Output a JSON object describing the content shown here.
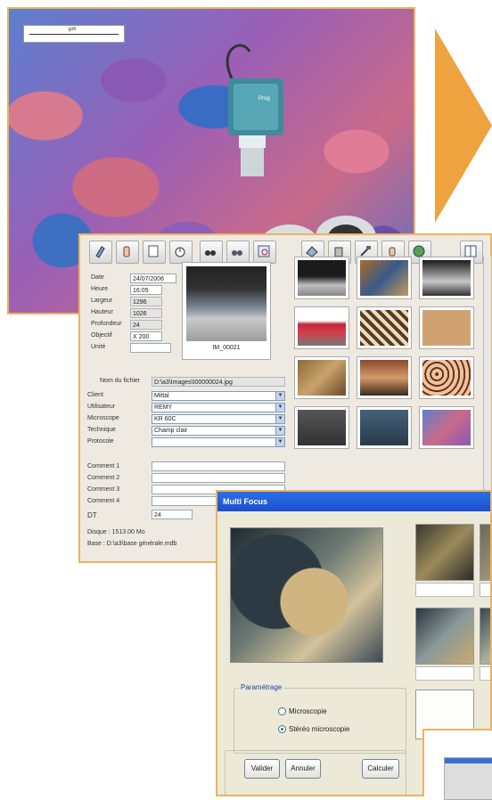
{
  "colors": {
    "frame": "#e9b45f",
    "arrow": "#eea33f",
    "titlebar": "#1c4fd0"
  },
  "photo": {
    "scalebar_label": "μm"
  },
  "toolbar": {
    "buttons": [
      "pencil-icon",
      "hand-icon",
      "page-icon",
      "stopwatch-icon",
      "binoculars-icon",
      "binoculars-2-icon",
      "zoom-grid-icon",
      "eraser-icon",
      "trash-icon",
      "hammer-icon",
      "hand-tool-icon",
      "globe-icon",
      "layout-icon"
    ]
  },
  "record": {
    "date_label": "Date",
    "date_value": "24/07/2006",
    "heure_label": "Heure",
    "heure_value": "16:05",
    "largeur_label": "Largeur",
    "largeur_value": "1296",
    "hauteur_label": "Hauteur",
    "hauteur_value": "1026",
    "profondeur_label": "Profondeur",
    "profondeur_value": "24",
    "objectif_label": "Objectif",
    "objectif_value": "X 200",
    "unite_label": "Unité",
    "unite_value": "",
    "preview_caption": "IM_00021",
    "nom_label": "Nom du fichier",
    "nom_value": "D:\\a3\\Images\\I00000024.jpg",
    "client_label": "Client",
    "client_value": "Mittal",
    "utilisateur_label": "Utilisateur",
    "utilisateur_value": "REMY",
    "microscope_label": "Microscope",
    "microscope_value": "KR 60C",
    "technique_label": "Technique",
    "technique_value": "Champ clair",
    "protocole_label": "Protocole",
    "protocole_value": "",
    "comment1_label": "Comment 1",
    "comment2_label": "Comment 2",
    "comment3_label": "Comment 3",
    "comment4_label": "Comment 4",
    "dt_label": "DT",
    "dt_value": "24",
    "disque_text": "Disque :    1513.00 Mo",
    "base_text": "Base :    D:\\a3\\base générale.mdb"
  },
  "multifocus": {
    "title": "Multi Focus",
    "parametrage_label": "Paramétrage",
    "option1": "Microscopie",
    "option2": "Stéréo microscopie",
    "selected": "Stéréo microscopie",
    "valider": "Valider",
    "annuler": "Annuler",
    "calculer": "Calculer"
  }
}
